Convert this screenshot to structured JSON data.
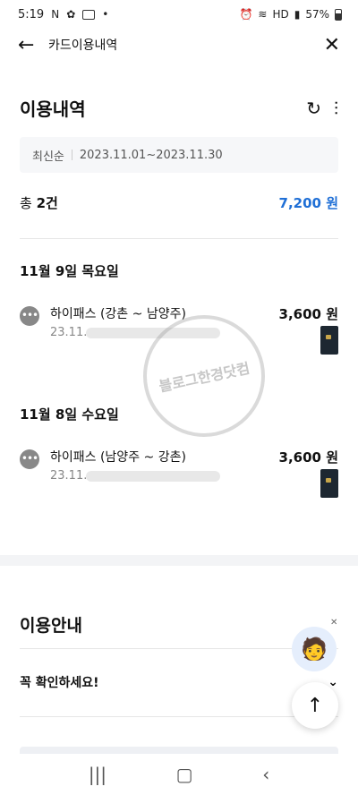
{
  "status_bar": {
    "time": "5:19",
    "battery_percent": "57%",
    "network": "HD"
  },
  "app_bar": {
    "title": "카드이용내역"
  },
  "section": {
    "title": "이용내역"
  },
  "filter": {
    "sort": "최신순",
    "period": "2023.11.01~2023.11.30"
  },
  "total": {
    "label": "총",
    "count": "2건",
    "amount": "7,200 원"
  },
  "groups": [
    {
      "day": "11월 9일 목요일",
      "transactions": [
        {
          "name": "하이패스 (강촌 ~ 남양주)",
          "date": "23.11.",
          "amount": "3,600 원"
        }
      ]
    },
    {
      "day": "11월 8일 수요일",
      "transactions": [
        {
          "name": "하이패스 (남양주 ~ 강촌)",
          "date": "23.11.",
          "amount": "3,600 원"
        }
      ]
    }
  ],
  "watermark": "블로그한경닷컴",
  "info": {
    "title": "이용안내",
    "check_label": "꼭 확인하세요!"
  },
  "icons": {
    "back": "arrow-left-icon",
    "close": "close-icon",
    "refresh": "refresh-icon",
    "filter": "sliders-icon",
    "more": "more-dots-icon",
    "card": "card-icon",
    "chevron": "chevron-down-icon",
    "scroll_top": "arrow-up-icon"
  },
  "colors": {
    "accent": "#1f6fd6",
    "card": "#1d2731"
  }
}
